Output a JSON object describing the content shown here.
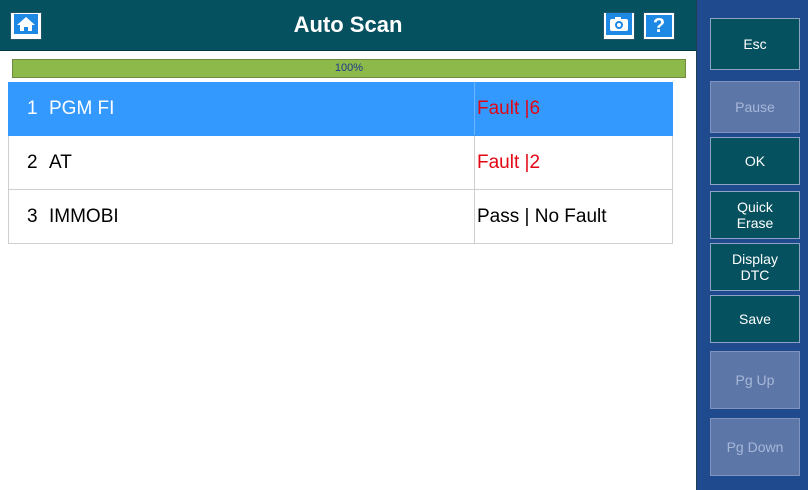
{
  "header": {
    "title": "Auto Scan",
    "home_icon": "home-icon",
    "camera_icon": "camera-icon",
    "help_label": "?"
  },
  "progress": {
    "value": 1.0,
    "label": "100%"
  },
  "rows": [
    {
      "num": "1",
      "name": "PGM FI",
      "status": "Fault |6",
      "status_kind": "fault",
      "selected": true
    },
    {
      "num": "2",
      "name": "AT",
      "status": "Fault |2",
      "status_kind": "fault",
      "selected": false
    },
    {
      "num": "3",
      "name": "IMMOBI",
      "status": "Pass | No Fault",
      "status_kind": "pass",
      "selected": false
    }
  ],
  "sidebar": {
    "buttons": [
      {
        "label": "Esc",
        "enabled": true
      },
      {
        "label": "Pause",
        "enabled": false
      },
      {
        "label": "OK",
        "enabled": true
      },
      {
        "label_line1": "Quick",
        "label_line2": "Erase",
        "enabled": true
      },
      {
        "label_line1": "Display",
        "label_line2": "DTC",
        "enabled": true
      },
      {
        "label": "Save",
        "enabled": true
      },
      {
        "label": "Pg Up",
        "enabled": false
      },
      {
        "label": "Pg Down",
        "enabled": false
      }
    ]
  },
  "colors": {
    "header_bg": "#06515f",
    "sidebar_bg": "#1f4a8e",
    "selected_row": "#3399ff",
    "fault_text": "#e30613",
    "progress": "#8db84a"
  }
}
